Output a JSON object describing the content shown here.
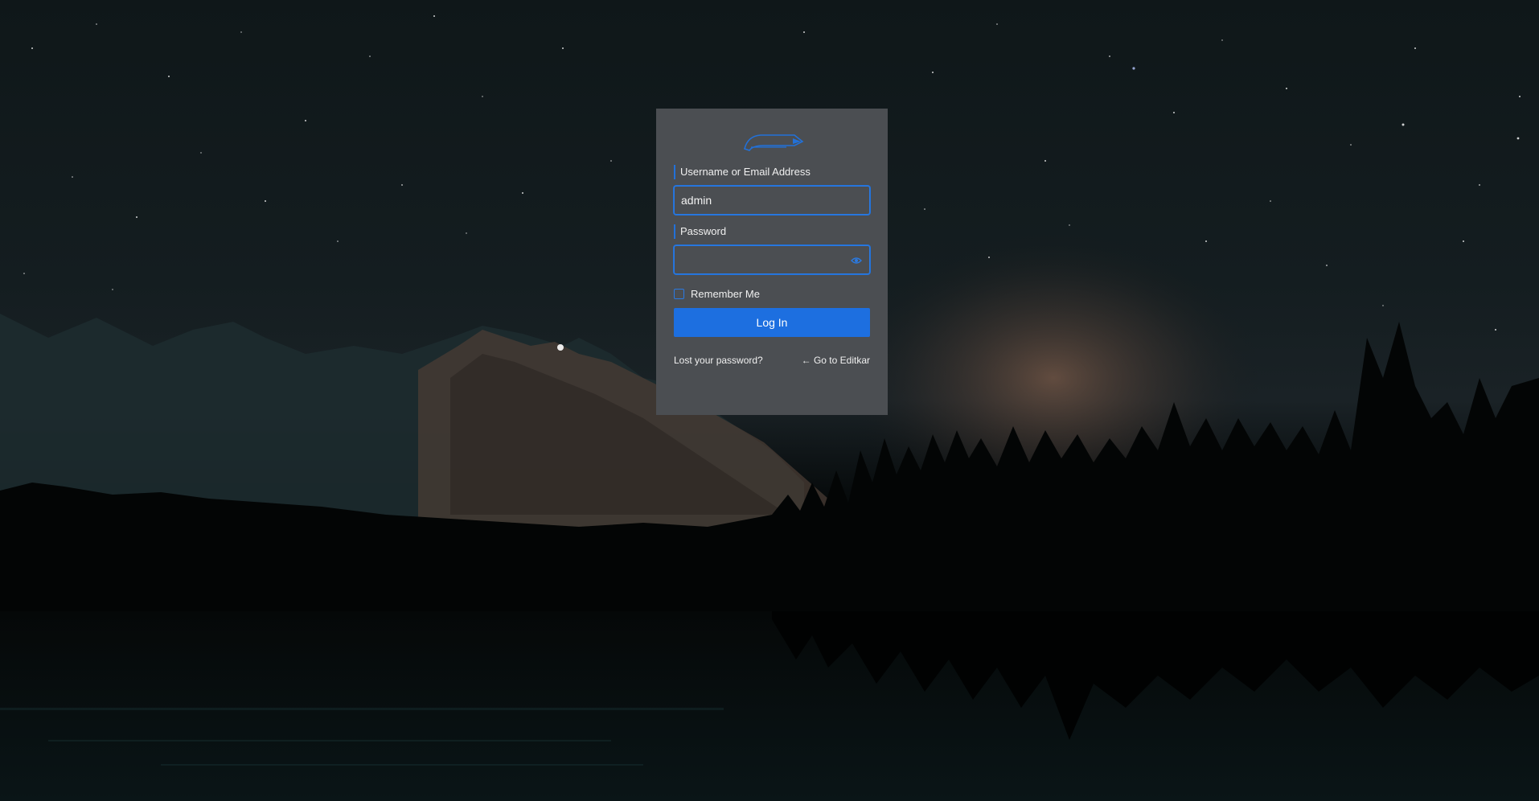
{
  "brand": {
    "logo_text": "Editkar",
    "accent_color": "#1d6fe0"
  },
  "login": {
    "username_label": "Username or Email Address",
    "username_value": "admin",
    "password_label": "Password",
    "password_value": "",
    "show_password_icon": "eye-icon",
    "remember_label": "Remember Me",
    "remember_checked": false,
    "submit_label": "Log In"
  },
  "links": {
    "lost_password": "Lost your password?",
    "back_to_site": "← Go to Editkar"
  }
}
